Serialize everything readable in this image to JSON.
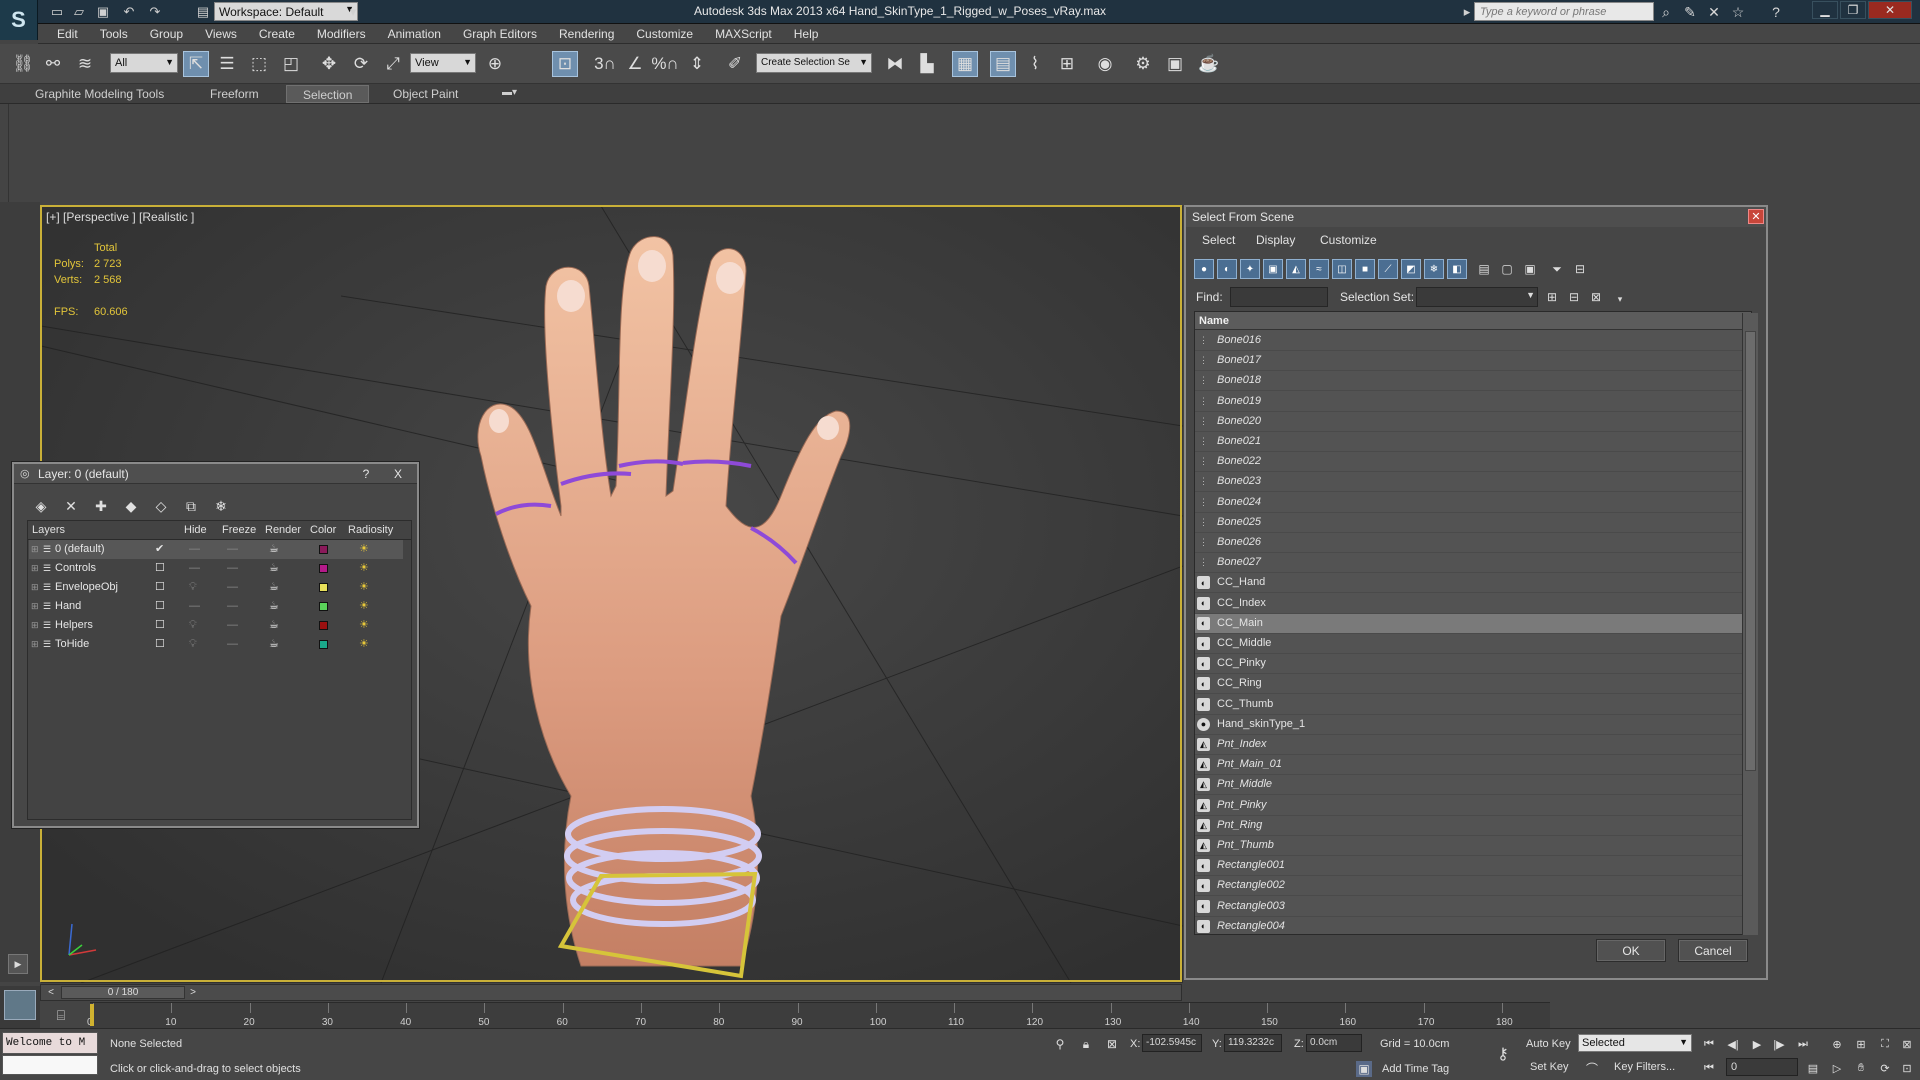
{
  "window": {
    "title": "Autodesk 3ds Max  2013 x64     Hand_SkinType_1_Rigged_w_Poses_vRay.max",
    "workspace": "Workspace: Default",
    "search_placeholder": "Type a keyword or phrase"
  },
  "menu": [
    "Edit",
    "Tools",
    "Group",
    "Views",
    "Create",
    "Modifiers",
    "Animation",
    "Graph Editors",
    "Rendering",
    "Customize",
    "MAXScript",
    "Help"
  ],
  "toolbar": {
    "selection_filter": "All",
    "ref_coord": "View",
    "named_selection": "Create Selection Se",
    "snap_3": "3",
    "snap_angle": "",
    "snap_percent": "%"
  },
  "ribbon": {
    "tabs": [
      "Graphite Modeling Tools",
      "Freeform",
      "Selection",
      "Object Paint"
    ],
    "active_tab": "Selection"
  },
  "viewport": {
    "label": "[+] [Perspective ] [Realistic ]",
    "stats": {
      "total_label": "Total",
      "polys_label": "Polys:",
      "polys": "2 723",
      "verts_label": "Verts:",
      "verts": "2 568",
      "fps_label": "FPS:",
      "fps": "60.606"
    }
  },
  "layer_dialog": {
    "title": "Layer: 0 (default)",
    "help": "?",
    "close": "X",
    "columns": [
      "Layers",
      "Hide",
      "Freeze",
      "Render",
      "Color",
      "Radiosity"
    ],
    "layers": [
      {
        "name": "0 (default)",
        "color": "#8a1a5a",
        "active": true
      },
      {
        "name": "Controls",
        "color": "#b41a8a"
      },
      {
        "name": "EnvelopeObj",
        "color": "#e8e05a"
      },
      {
        "name": "Hand",
        "color": "#5ad25a"
      },
      {
        "name": "Helpers",
        "color": "#9a1010"
      },
      {
        "name": "ToHide",
        "color": "#1aa88a"
      }
    ]
  },
  "select_from_scene": {
    "title": "Select From Scene",
    "menu": [
      "Select",
      "Display",
      "Customize"
    ],
    "find_label": "Find:",
    "find_value": "",
    "selset_label": "Selection Set:",
    "selset_value": "",
    "column": "Name",
    "items": [
      {
        "name": "Bone016",
        "type": "bone"
      },
      {
        "name": "Bone017",
        "type": "bone"
      },
      {
        "name": "Bone018",
        "type": "bone"
      },
      {
        "name": "Bone019",
        "type": "bone"
      },
      {
        "name": "Bone020",
        "type": "bone"
      },
      {
        "name": "Bone021",
        "type": "bone"
      },
      {
        "name": "Bone022",
        "type": "bone"
      },
      {
        "name": "Bone023",
        "type": "bone"
      },
      {
        "name": "Bone024",
        "type": "bone"
      },
      {
        "name": "Bone025",
        "type": "bone"
      },
      {
        "name": "Bone026",
        "type": "bone"
      },
      {
        "name": "Bone027",
        "type": "bone"
      },
      {
        "name": "CC_Hand",
        "type": "shape"
      },
      {
        "name": "CC_Index",
        "type": "shape"
      },
      {
        "name": "CC_Main",
        "type": "shape",
        "selected": true
      },
      {
        "name": "CC_Middle",
        "type": "shape"
      },
      {
        "name": "CC_Pinky",
        "type": "shape"
      },
      {
        "name": "CC_Ring",
        "type": "shape"
      },
      {
        "name": "CC_Thumb",
        "type": "shape"
      },
      {
        "name": "Hand_skinType_1",
        "type": "geometry"
      },
      {
        "name": "Pnt_Index",
        "type": "helper"
      },
      {
        "name": "Pnt_Main_01",
        "type": "helper"
      },
      {
        "name": "Pnt_Middle",
        "type": "helper"
      },
      {
        "name": "Pnt_Pinky",
        "type": "helper"
      },
      {
        "name": "Pnt_Ring",
        "type": "helper"
      },
      {
        "name": "Pnt_Thumb",
        "type": "helper"
      },
      {
        "name": "Rectangle001",
        "type": "shape-i"
      },
      {
        "name": "Rectangle002",
        "type": "shape-i"
      },
      {
        "name": "Rectangle003",
        "type": "shape-i"
      },
      {
        "name": "Rectangle004",
        "type": "shape-i"
      }
    ],
    "ok": "OK",
    "cancel": "Cancel"
  },
  "timeline": {
    "frame_display": "0 / 180",
    "ticks": [
      "0",
      "10",
      "20",
      "30",
      "40",
      "50",
      "60",
      "70",
      "80",
      "90",
      "100",
      "110",
      "120",
      "130",
      "140",
      "150",
      "160",
      "170",
      "180"
    ]
  },
  "status": {
    "welcome": "Welcome to M",
    "selection": "None Selected",
    "prompt": "Click or click-and-drag to select objects",
    "x_label": "X:",
    "x": "-102.5945c",
    "y_label": "Y:",
    "y": "119.3232c",
    "z_label": "Z:",
    "z": "0.0cm",
    "grid": "Grid = 10.0cm",
    "add_time_tag": "Add Time Tag",
    "auto_key": "Auto Key",
    "set_key": "Set Key",
    "key_mode": "Selected",
    "key_filters": "Key Filters...",
    "frame": "0"
  }
}
